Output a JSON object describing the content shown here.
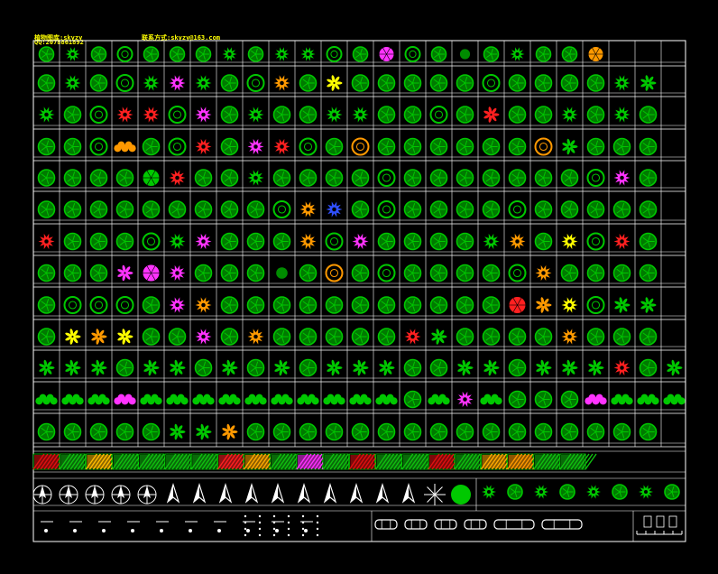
{
  "header": {
    "line1": "植物图库:skyzy",
    "line2": "QQ:2078861892",
    "contact": "联系方式:skyzy@163.com"
  },
  "palette": {
    "background": "#000000",
    "grid": "#ffffff",
    "tree_green": "#00c800",
    "tree_dark": "#007a00",
    "magenta": "#ff33ff",
    "orange": "#ff9900",
    "red": "#ff2020",
    "yellow": "#ffff00",
    "blue": "#3050ff",
    "pattern_border": "#00ff00"
  },
  "symbol_rows": [
    [
      "sd",
      "ss",
      "sd",
      "so",
      "sd",
      "sd",
      "sd",
      "ss",
      "sd",
      "ss",
      "ss",
      "so",
      "sd",
      "Mf",
      "so",
      "sd",
      "sg",
      "sd",
      "ss",
      "sd",
      "sd",
      "Of"
    ],
    [
      "sd",
      "ss",
      "sd",
      "so",
      "ss",
      "Ms",
      "ss",
      "sd",
      "so",
      "Os",
      "sd",
      "Yx",
      "sd",
      "sd",
      "sd",
      "sd",
      "sd",
      "so",
      "sd",
      "sd",
      "sd",
      "sd",
      "ss",
      "sx"
    ],
    [
      "ss",
      "sd",
      "so",
      "Rs",
      "Rs",
      "so",
      "Ms",
      "sd",
      "ss",
      "sd",
      "sd",
      "ss",
      "ss",
      "sd",
      "sd",
      "so",
      "sd",
      "Rx",
      "sd",
      "sd",
      "ss",
      "sd",
      "ss",
      "sd"
    ],
    [
      "sd",
      "sd",
      "so",
      "Ob",
      "sd",
      "so",
      "Rs",
      "sd",
      "Ms",
      "Rs",
      "So",
      "sd",
      "Oo",
      "sd",
      "sd",
      "sd",
      "sd",
      "sd",
      "sd",
      "Oo",
      "sx",
      "sd",
      "sd",
      "sd"
    ],
    [
      "sd",
      "sd",
      "sd",
      "sd",
      "sf",
      "Rs",
      "sd",
      "sd",
      "ss",
      "sd",
      "sd",
      "sd",
      "sd",
      "so",
      "sd",
      "sd",
      "sd",
      "sd",
      "sd",
      "sd",
      "sd",
      "so",
      "Ms",
      "sd"
    ],
    [
      "sd",
      "sd",
      "sd",
      "sd",
      "sd",
      "sd",
      "sd",
      "sd",
      "sd",
      "so",
      "Os",
      "Bs",
      "sd",
      "so",
      "sd",
      "sd",
      "sd",
      "sd",
      "so",
      "sd",
      "sd",
      "sd",
      "sd",
      "sd"
    ],
    [
      "Rs",
      "sd",
      "sd",
      "sd",
      "so",
      "ss",
      "Ms",
      "sd",
      "sd",
      "sd",
      "Os",
      "so",
      "Ms",
      "sd",
      "sd",
      "sd",
      "sd",
      "ss",
      "Os",
      "sd",
      "Ys",
      "so",
      "Rs",
      "sd"
    ],
    [
      "sd",
      "sd",
      "sd",
      "Mx",
      "Mf",
      "Ms",
      "sd",
      "sd",
      "sd",
      "sg",
      "sd",
      "Oo",
      "sd",
      "so",
      "sd",
      "sd",
      "sd",
      "sd",
      "so",
      "Os",
      "sd",
      "sd",
      "sd",
      "sd"
    ],
    [
      "sd",
      "so",
      "so",
      "so",
      "sd",
      "Ms",
      "Os",
      "sd",
      "sd",
      "sd",
      "sd",
      "sd",
      "sd",
      "sd",
      "sd",
      "sd",
      "sd",
      "sd",
      "Rf",
      "Ox",
      "Ys",
      "so",
      "sx",
      "sx"
    ],
    [
      "sd",
      "Yx",
      "Ox",
      "Yx",
      "sd",
      "sd",
      "Ms",
      "sd",
      "Os",
      "sd",
      "sd",
      "sd",
      "sd",
      "sd",
      "Rs",
      "sx",
      "sd",
      "sd",
      "sd",
      "sd",
      "Os",
      "sd",
      "sd",
      "sd"
    ],
    [
      "sx",
      "sx",
      "sx",
      "sd",
      "sx",
      "sx",
      "sd",
      "sx",
      "sd",
      "sx",
      "sd",
      "sx",
      "sx",
      "sx",
      "sd",
      "sd",
      "sx",
      "sx",
      "sd",
      "sx",
      "sx",
      "sx",
      "Rs",
      "sd",
      "sx"
    ],
    [
      "sb",
      "sb",
      "sb",
      "Mb",
      "sb",
      "sb",
      "sb",
      "sb",
      "sb",
      "sb",
      "sb",
      "sb",
      "sb",
      "sb",
      "sd",
      "sb",
      "Ms",
      "sb",
      "sd",
      "sd",
      "sd",
      "Mb",
      "sb",
      "sb",
      "sb"
    ],
    [
      "sd",
      "sd",
      "sd",
      "sd",
      "sd",
      "sx",
      "sx",
      "Ox",
      "sd",
      "sd",
      "sd",
      "sd",
      "sd",
      "sd",
      "sd",
      "sd",
      "sd",
      "sd",
      "sd",
      "sd",
      "sd",
      "sd",
      "sd",
      "sd"
    ]
  ],
  "hatch_swatches": [
    "#e01010",
    "#10c010",
    "#ffbb00",
    "#10c010",
    "#10c010",
    "#10c010",
    "#10c010",
    "#ff2020",
    "#ffaa00",
    "#10c010",
    "#ff33ff",
    "#10c010",
    "#e01010",
    "#10c010",
    "#10c010",
    "#e01010",
    "#10c010",
    "#ffaa00",
    "#ff9900",
    "#10c010",
    "#10c010"
  ],
  "compass_symbols": [
    "north-arrow-1",
    "north-arrow-2",
    "north-arrow-3",
    "north-arrow-4",
    "north-arrow-5",
    "north-arrow-6",
    "north-arrow-7",
    "north-arrow-8",
    "north-arrow-9",
    "north-arrow-10",
    "north-arrow-11",
    "north-arrow-12",
    "north-arrow-13",
    "north-arrow-14",
    "north-arrow-15",
    "north-arrow-16",
    "north-arrow-17"
  ],
  "shrub_row": 8,
  "vehicle_symbols": [
    "car-1",
    "car-2",
    "car-3",
    "car-4",
    "bus-1",
    "bus-2"
  ]
}
